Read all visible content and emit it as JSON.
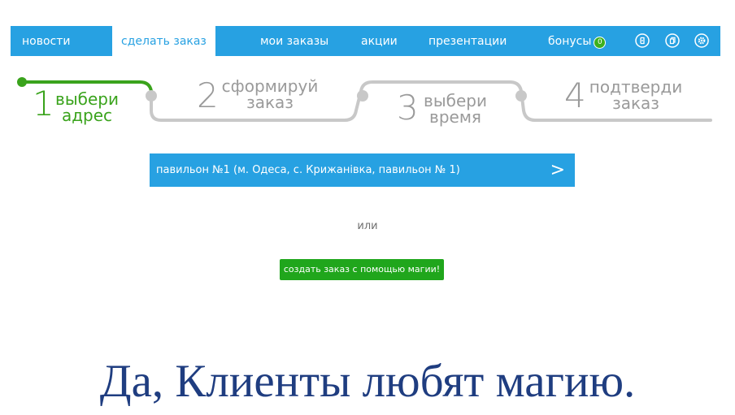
{
  "nav": {
    "items": [
      {
        "label": "новости",
        "active": false
      },
      {
        "label": "сделать заказ",
        "active": true
      },
      {
        "label": "мои заказы",
        "active": false
      },
      {
        "label": "акции",
        "active": false
      },
      {
        "label": "презентации",
        "active": false
      }
    ],
    "bonus": {
      "label": "бонусы",
      "count": "0"
    },
    "icons": [
      "logout-icon",
      "copy-icon",
      "gear-icon"
    ]
  },
  "steps": [
    {
      "number": "1",
      "line1": "выбери",
      "line2": "адрес",
      "active": true
    },
    {
      "number": "2",
      "line1": "сформируй",
      "line2": "заказ",
      "active": false
    },
    {
      "number": "3",
      "line1": "выбери",
      "line2": "время",
      "active": false
    },
    {
      "number": "4",
      "line1": "подтверди",
      "line2": "заказ",
      "active": false
    }
  ],
  "address": {
    "text": "павильон №1 (м. Одеса, с. Крижанівка, павильон № 1)",
    "arrow": ">"
  },
  "or_text": "или",
  "magic_button": "создать заказ с помощью магии!",
  "caption": "Да, Клиенты любят магию.",
  "colors": {
    "nav_blue": "#27a1e2",
    "step_green": "#3aa31c",
    "step_gray": "#c8c8c8",
    "button_green": "#20a61c",
    "caption_blue": "#1f3d80"
  }
}
